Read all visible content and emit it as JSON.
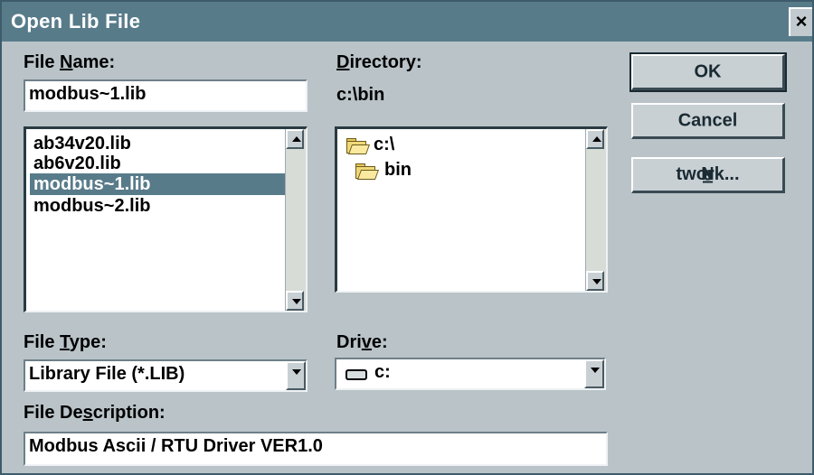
{
  "window": {
    "title": "Open Lib File",
    "close_label": "×"
  },
  "file_name": {
    "label_pre": "File ",
    "label_accel": "N",
    "label_post": "ame:",
    "value": "modbus~1.lib"
  },
  "files": [
    {
      "name": "ab34v20.lib",
      "selected": false
    },
    {
      "name": "ab6v20.lib",
      "selected": false
    },
    {
      "name": "modbus~1.lib",
      "selected": true
    },
    {
      "name": "modbus~2.lib",
      "selected": false
    }
  ],
  "directory": {
    "label_accel": "D",
    "label_post": "irectory:",
    "path": "c:\\bin",
    "items": [
      {
        "name": "c:\\"
      },
      {
        "name": "bin"
      }
    ]
  },
  "buttons": {
    "ok": "OK",
    "cancel": "Cancel",
    "network_pre": "N",
    "network_accel": "e",
    "network_post": "twork..."
  },
  "file_type": {
    "label_pre": "File ",
    "label_accel": "T",
    "label_post": "ype:",
    "value": "Library File (*.LIB)"
  },
  "drive": {
    "label_pre": "Dri",
    "label_accel": "v",
    "label_post": "e:",
    "value": "c:"
  },
  "file_description": {
    "label_pre": "File De",
    "label_accel": "s",
    "label_post": "cription:",
    "value": "Modbus Ascii / RTU Driver VER1.0"
  }
}
